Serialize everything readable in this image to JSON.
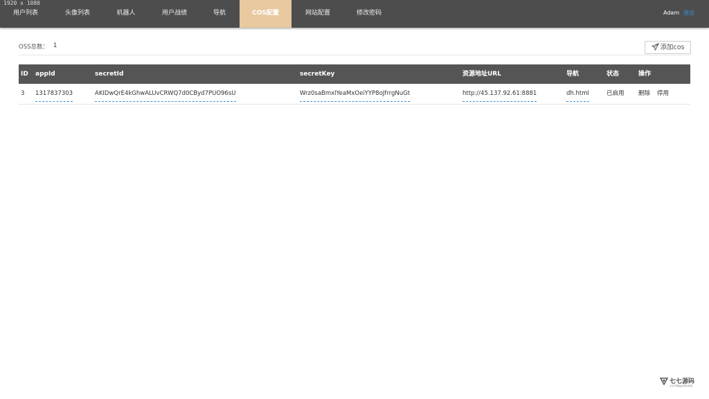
{
  "resolution_label": "1920 x 1080",
  "nav": {
    "items": [
      {
        "label": "用户列表"
      },
      {
        "label": "头像列表"
      },
      {
        "label": "机器人"
      },
      {
        "label": "用户战绩"
      },
      {
        "label": "导航"
      },
      {
        "label": "COS配置",
        "active": true
      },
      {
        "label": "网站配置"
      },
      {
        "label": "修改密码"
      }
    ],
    "username": "Adam",
    "logout_label": "退出"
  },
  "summary": {
    "count_label": "OSS总数：",
    "count_value": "1"
  },
  "toolbar": {
    "add_label": "添加cos",
    "add_icon": "paper-plane-icon"
  },
  "table": {
    "headers": [
      "ID",
      "appId",
      "secretId",
      "secretKey",
      "资源地址URL",
      "导航",
      "状态",
      "操作"
    ],
    "rows": [
      {
        "id": "3",
        "appId": "1317837303",
        "secretId": "AKIDwQrE4kGhwALUvCRWQ7d0CByd7PUO96sU",
        "secretKey": "Wrz0saBmxlYeaMxOeiYYP8oJfrrgNuGt",
        "url": "http://45.137.92.61:8881",
        "nav": "dh.html",
        "status": "已启用",
        "actions": [
          "删除",
          "停用"
        ]
      }
    ]
  },
  "watermark": {
    "title": "七七源码",
    "subtitle": "分享开源精品源码社区网"
  },
  "colors": {
    "navbar": "#4d4d4d",
    "active_tab": "#e8c9a0",
    "table_header": "#555555",
    "link": "#3a8fd8"
  }
}
